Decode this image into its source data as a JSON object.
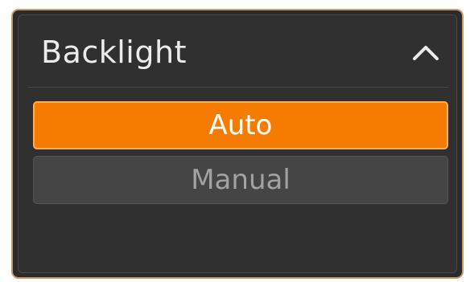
{
  "panel": {
    "title": "Backlight",
    "collapse_icon": "chevron-up-icon",
    "options": [
      {
        "label": "Auto",
        "selected": true
      },
      {
        "label": "Manual",
        "selected": false
      }
    ]
  },
  "colors": {
    "accent": "#f57c00",
    "panel_bg": "#303030",
    "frame_border": "#c89a6a",
    "unselected_bg": "#454545"
  }
}
